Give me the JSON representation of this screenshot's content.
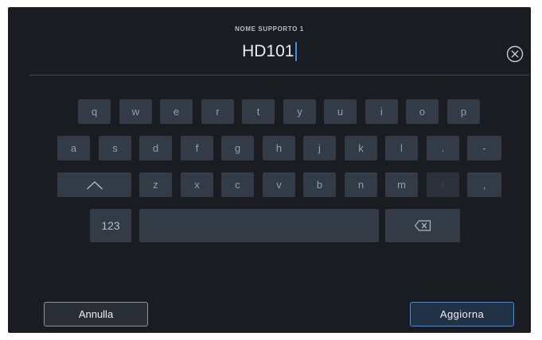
{
  "header": {
    "caption": "NOME SUPPORTO 1",
    "value": "HD101",
    "clear_icon": "circle-x-icon"
  },
  "keyboard": {
    "row1": [
      "q",
      "w",
      "e",
      "r",
      "t",
      "y",
      "u",
      "i",
      "o",
      "p"
    ],
    "row2": [
      "a",
      "s",
      "d",
      "f",
      "g",
      "h",
      "j",
      "k",
      "l",
      ".",
      "-"
    ],
    "row3": [
      "z",
      "x",
      "c",
      "v",
      "b",
      "n",
      "m",
      "/",
      ","
    ],
    "row3_disabled": [
      "/"
    ],
    "shift_icon": "chevron-up-icon",
    "numbers_label": "123",
    "space_label": "",
    "backspace_icon": "backspace-icon"
  },
  "footer": {
    "cancel_label": "Annulla",
    "update_label": "Aggiorna"
  },
  "colors": {
    "background": "#191c21",
    "key": "#333b46",
    "key_text": "#95a0ad",
    "accent": "#3b8ff0"
  }
}
